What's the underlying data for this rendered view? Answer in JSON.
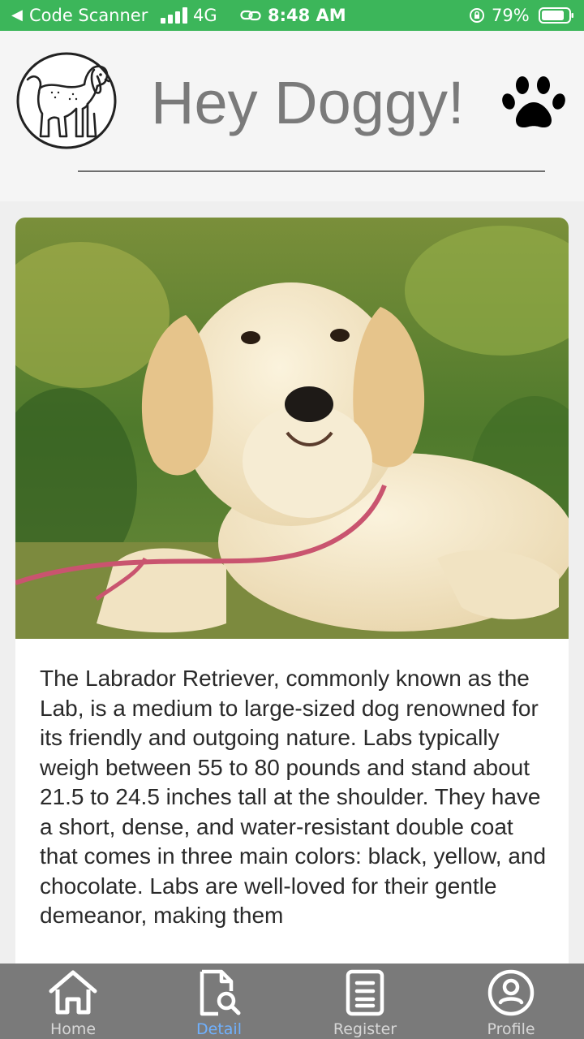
{
  "status_bar": {
    "back_glyph": "◀",
    "app_name": "Code Scanner",
    "network": "4G",
    "time": "8:48 AM",
    "battery": "79%",
    "icons": [
      "signal-icon",
      "link-icon",
      "orientation-lock-icon",
      "battery-icon"
    ]
  },
  "header": {
    "title": "Hey Doggy!",
    "logo_icon": "dog-outline-icon",
    "paw_icon": "paw-icon"
  },
  "detail": {
    "photo_description_icon": "labrador-puppy-photo",
    "text": "The Labrador Retriever, commonly known as the Lab, is a medium to large-sized dog renowned for its friendly and outgoing nature. Labs typically weigh between 55 to 80 pounds and stand about 21.5 to 24.5 inches tall at the shoulder. They have a short, dense, and water-resistant double coat that comes in three main colors: black, yellow, and chocolate. Labs are well-loved for their gentle demeanor, making them"
  },
  "tabs": [
    {
      "label": "Home",
      "icon": "home-icon",
      "active": false
    },
    {
      "label": "Detail",
      "icon": "document-search-icon",
      "active": true
    },
    {
      "label": "Register",
      "icon": "clipboard-list-icon",
      "active": false
    },
    {
      "label": "Profile",
      "icon": "profile-icon",
      "active": false
    }
  ],
  "colors": {
    "status_bar": "#3cb65a",
    "tab_bar": "#7a7a7a",
    "tab_active": "#6fb1ff",
    "title": "#7a7a7a"
  }
}
